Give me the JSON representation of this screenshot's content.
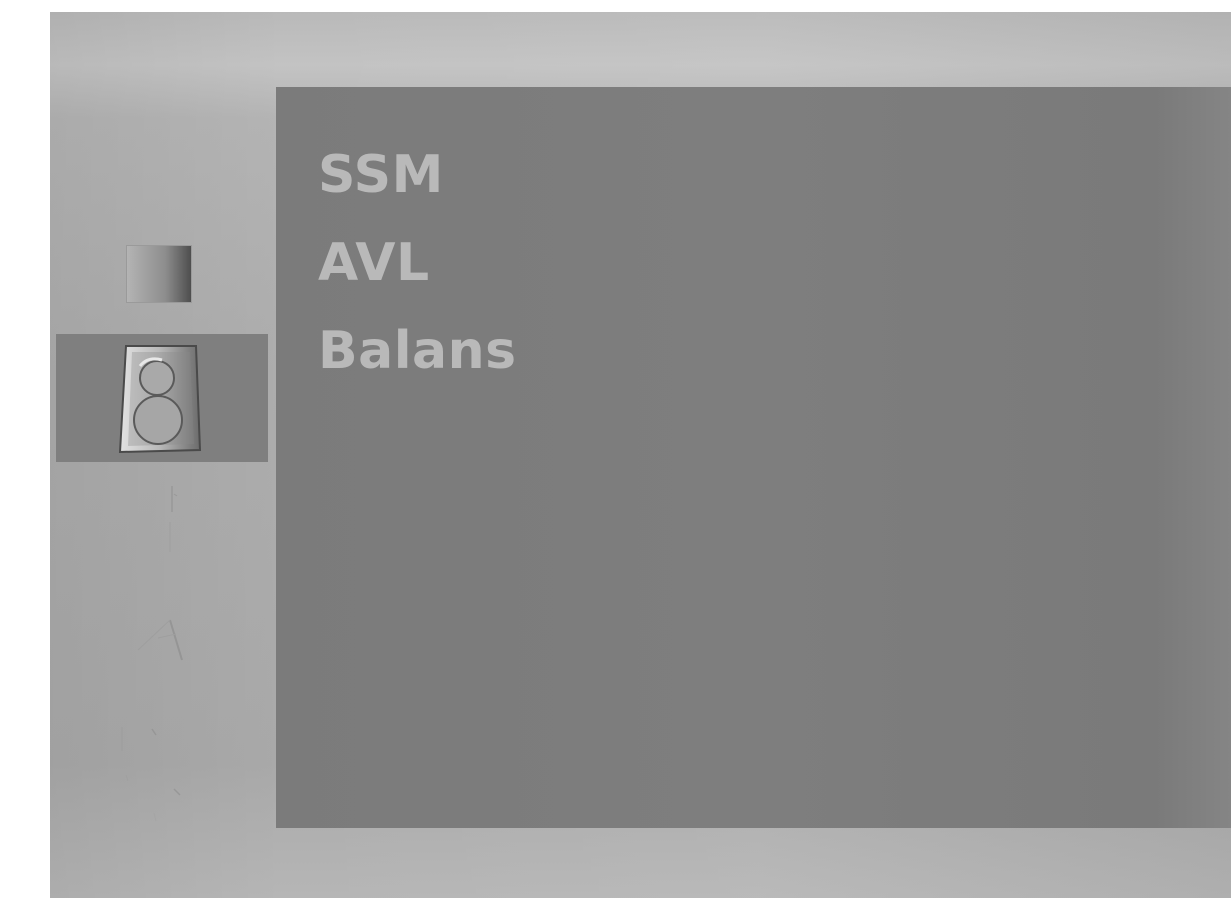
{
  "menu": {
    "items": [
      {
        "label": "SSM"
      },
      {
        "label": "AVL"
      },
      {
        "label": "Balans"
      }
    ]
  },
  "sidebar": {
    "items": [
      {
        "icon": "picture-icon",
        "selected": false
      },
      {
        "icon": "speaker-icon",
        "selected": true
      },
      {
        "icon": "clock-icon",
        "selected": false
      },
      {
        "icon": "special-icon",
        "selected": false
      },
      {
        "icon": "screen-icon",
        "selected": false
      }
    ]
  },
  "colors": {
    "frame": "#b1b1b1",
    "panel": "#7e7e7e",
    "selected_item": "#7f7f7f",
    "menu_text": "#b9b9b9"
  }
}
